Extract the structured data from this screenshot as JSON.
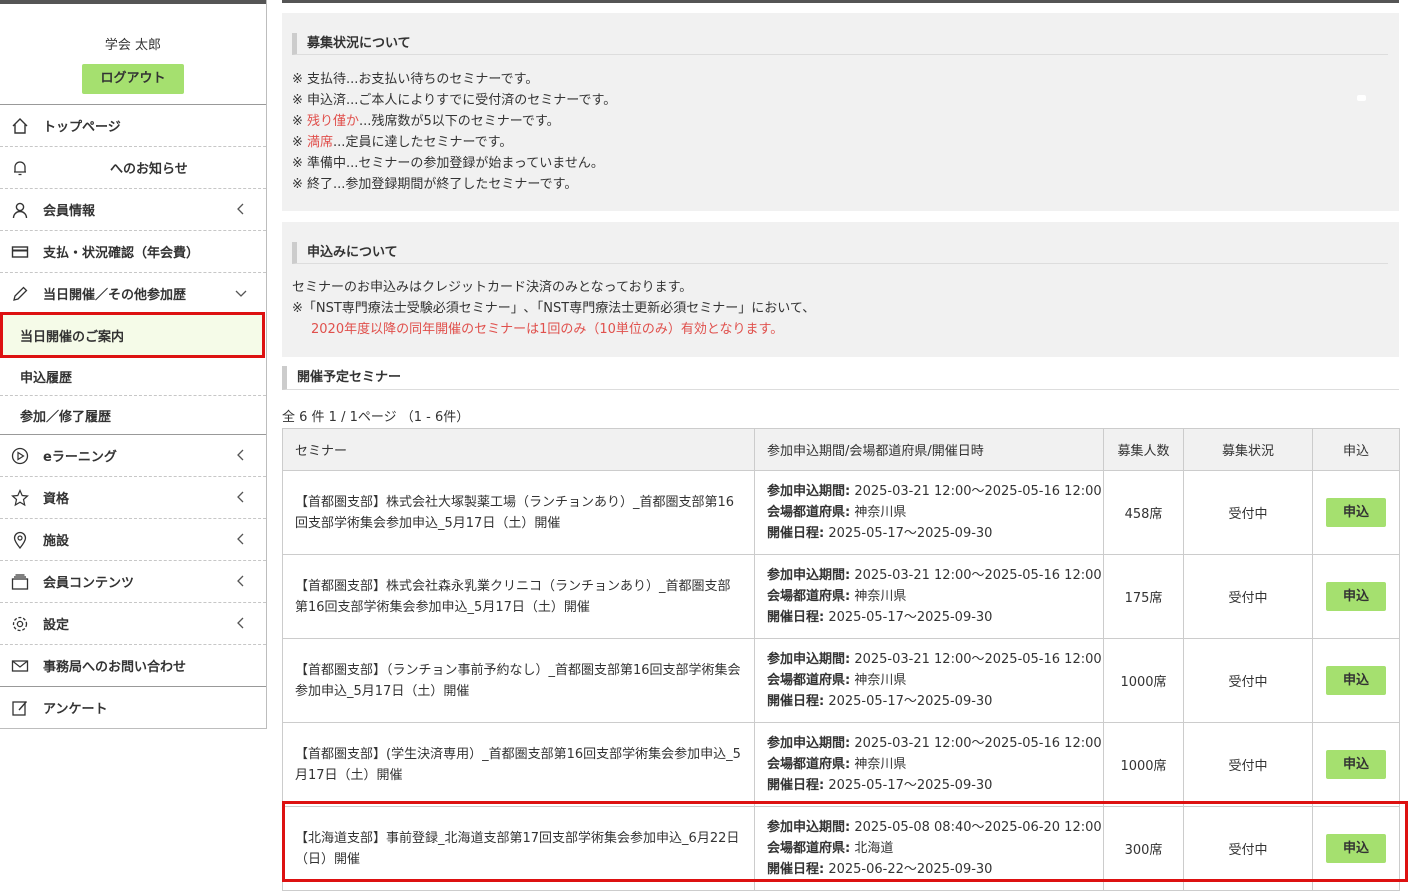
{
  "sidebar": {
    "user_name": "学会 太郎",
    "logout_label": "ログアウト",
    "items": [
      {
        "label": "トップページ",
        "icon": "home-icon"
      },
      {
        "label": "へのお知らせ",
        "icon": "bell-icon"
      },
      {
        "label": "会員情報",
        "icon": "user-icon"
      },
      {
        "label": "支払・状況確認（年会費）",
        "icon": "card-icon"
      },
      {
        "label": "当日開催／その他参加歴",
        "icon": "pencil-icon"
      },
      {
        "label": "eラーニング",
        "icon": "play-icon"
      },
      {
        "label": "資格",
        "icon": "star-icon"
      },
      {
        "label": "施設",
        "icon": "pin-icon"
      },
      {
        "label": "会員コンテンツ",
        "icon": "folder-icon"
      },
      {
        "label": "設定",
        "icon": "gear-icon"
      },
      {
        "label": "事務局へのお問い合わせ",
        "icon": "mail-icon"
      },
      {
        "label": "アンケート",
        "icon": "survey-icon"
      }
    ],
    "sub_items": [
      "当日開催のご案内",
      "申込履歴",
      "参加／修了履歴"
    ]
  },
  "status_box": {
    "title": "募集状況について",
    "lines": [
      {
        "prefix": "※ ",
        "highlight": "",
        "text": "支払待...お支払い待ちのセミナーです。"
      },
      {
        "prefix": "※ ",
        "highlight": "",
        "text": "申込済...ご本人によりすでに受付済のセミナーです。"
      },
      {
        "prefix": "※ ",
        "highlight": "残り僅か",
        "text": "...残席数が5以下のセミナーです。"
      },
      {
        "prefix": "※ ",
        "highlight": "満席",
        "text": "...定員に達したセミナーです。"
      },
      {
        "prefix": "※ ",
        "highlight": "",
        "text": "準備中...セミナーの参加登録が始まっていません。"
      },
      {
        "prefix": "※ ",
        "highlight": "",
        "text": "終了...参加登録期間が終了したセミナーです。"
      }
    ]
  },
  "apply_box": {
    "title": "申込みについて",
    "line1": "セミナーのお申込みはクレジットカード決済のみとなっております。",
    "line2": "※「NST専門療法士受験必須セミナー」､「NST専門療法士更新必須セミナー」において、",
    "line3": "2020年度以降の同年開催のセミナーは1回のみ（10単位のみ）有効となります。"
  },
  "schedule": {
    "title": "開催予定セミナー",
    "count": "全 6 件 1 / 1ページ （1 - 6件）",
    "headers": [
      "セミナー",
      "参加申込期間/会場都道府県/開催日時",
      "募集人数",
      "募集状況",
      "申込"
    ],
    "period_label": "参加申込期間:",
    "pref_label": "会場都道府県:",
    "date_label": "開催日程:",
    "rows": [
      {
        "title": "【首都圏支部】株式会社大塚製薬工場（ランチョンあり）_首都圏支部第16回支部学術集会参加申込_5月17日（土）開催",
        "period": "2025-03-21 12:00〜2025-05-16 12:00",
        "pref": "神奈川県",
        "date": "2025-05-17〜2025-09-30",
        "capacity": "458席",
        "status": "受付中",
        "apply": "申込"
      },
      {
        "title": "【首都圏支部】株式会社森永乳業クリニコ（ランチョンあり）_首都圏支部第16回支部学術集会参加申込_5月17日（土）開催",
        "period": "2025-03-21 12:00〜2025-05-16 12:00",
        "pref": "神奈川県",
        "date": "2025-05-17〜2025-09-30",
        "capacity": "175席",
        "status": "受付中",
        "apply": "申込"
      },
      {
        "title": "【首都圏支部】（ランチョン事前予約なし）_首都圏支部第16回支部学術集会参加申込_5月17日（土）開催",
        "period": "2025-03-21 12:00〜2025-05-16 12:00",
        "pref": "神奈川県",
        "date": "2025-05-17〜2025-09-30",
        "capacity": "1000席",
        "status": "受付中",
        "apply": "申込"
      },
      {
        "title": "【首都圏支部】(学生決済専用）_首都圏支部第16回支部学術集会参加申込_5月17日（土）開催",
        "period": "2025-03-21 12:00〜2025-05-16 12:00",
        "pref": "神奈川県",
        "date": "2025-05-17〜2025-09-30",
        "capacity": "1000席",
        "status": "受付中",
        "apply": "申込"
      },
      {
        "title": "【北海道支部】事前登録_北海道支部第17回支部学術集会参加申込_6月22日（日）開催",
        "period": "2025-05-08 08:40〜2025-06-20 12:00",
        "pref": "北海道",
        "date": "2025-06-22〜2025-09-30",
        "capacity": "300席",
        "status": "受付中",
        "apply": "申込"
      }
    ]
  }
}
